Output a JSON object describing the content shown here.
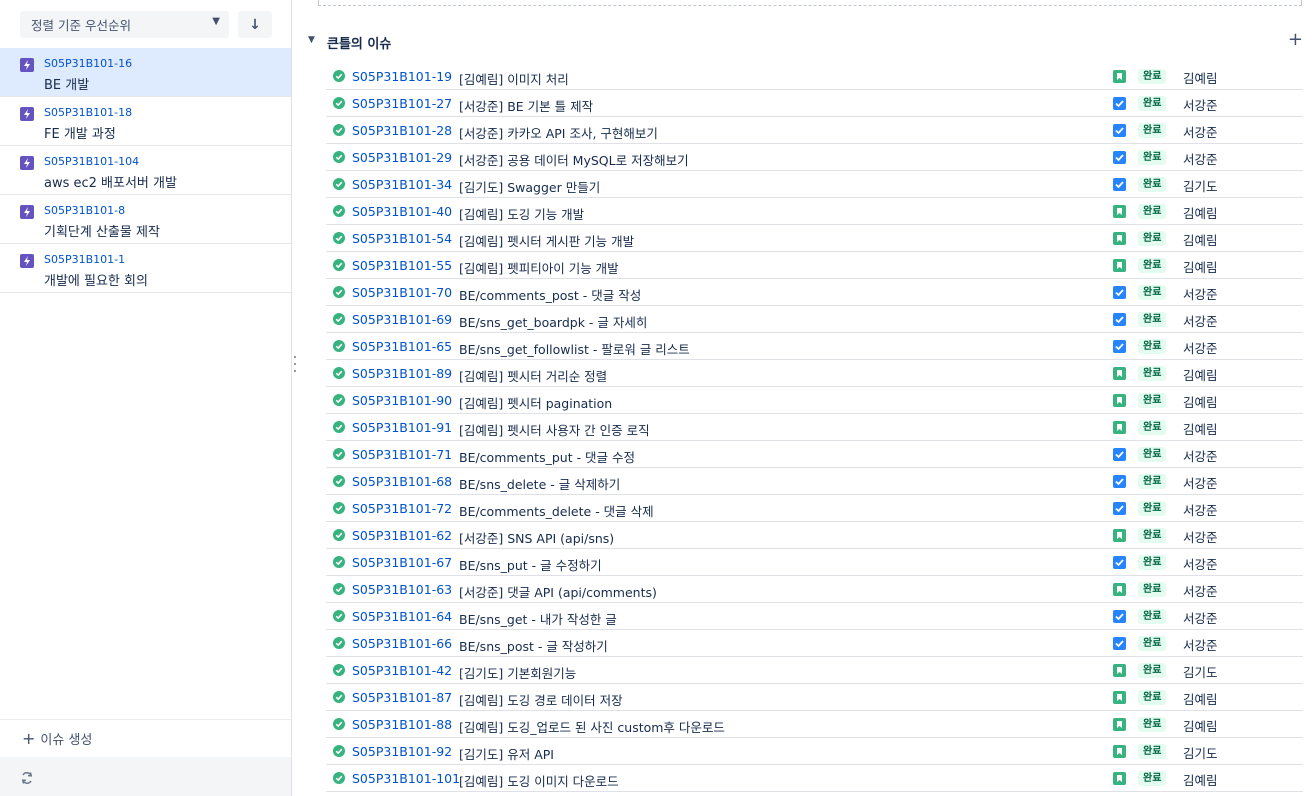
{
  "sidebar": {
    "sort_label": "정렬 기준 우선순위",
    "sort_direction_icon": "arrow-down-icon",
    "epics": [
      {
        "key": "S05P31B101-16",
        "title": "BE 개발"
      },
      {
        "key": "S05P31B101-18",
        "title": "FE 개발 과정"
      },
      {
        "key": "S05P31B101-104",
        "title": "aws ec2 배포서버 개발"
      },
      {
        "key": "S05P31B101-8",
        "title": "기획단계 산출물 제작"
      },
      {
        "key": "S05P31B101-1",
        "title": "개발에 필요한 회의"
      }
    ],
    "selected_epic_index": 0,
    "create_issue_label": "이슈 생성"
  },
  "section": {
    "title": "큰틀의 이슈"
  },
  "colors": {
    "epic": "#6554c0",
    "done_green": "#36b37e",
    "task_blue": "#2684ff",
    "link_blue": "#0052cc",
    "badge_bg": "#e3fcef",
    "badge_text": "#006644",
    "selected_bg": "#deebff"
  },
  "issues": [
    {
      "key": "S05P31B101-19",
      "summary": "[김예림] 이미지 처리",
      "type": "story",
      "status": "완료",
      "assignee": "김예림"
    },
    {
      "key": "S05P31B101-27",
      "summary": "[서강준] BE 기본 틀 제작",
      "type": "task",
      "status": "완료",
      "assignee": "서강준"
    },
    {
      "key": "S05P31B101-28",
      "summary": "[서강준] 카카오 API 조사, 구현해보기",
      "type": "task",
      "status": "완료",
      "assignee": "서강준"
    },
    {
      "key": "S05P31B101-29",
      "summary": "[서강준] 공용 데이터 MySQL로 저장해보기",
      "type": "task",
      "status": "완료",
      "assignee": "서강준"
    },
    {
      "key": "S05P31B101-34",
      "summary": "[김기도] Swagger 만들기",
      "type": "task",
      "status": "완료",
      "assignee": "김기도"
    },
    {
      "key": "S05P31B101-40",
      "summary": "[김예림] 도깅 기능 개발",
      "type": "story",
      "status": "완료",
      "assignee": "김예림"
    },
    {
      "key": "S05P31B101-54",
      "summary": "[김예림] 펫시터 게시판 기능 개발",
      "type": "story",
      "status": "완료",
      "assignee": "김예림"
    },
    {
      "key": "S05P31B101-55",
      "summary": "[김예림] 펫피티아이 기능 개발",
      "type": "story",
      "status": "완료",
      "assignee": "김예림"
    },
    {
      "key": "S05P31B101-70",
      "summary": "BE/comments_post - 댓글 작성",
      "type": "task",
      "status": "완료",
      "assignee": "서강준"
    },
    {
      "key": "S05P31B101-69",
      "summary": "BE/sns_get_boardpk - 글 자세히",
      "type": "task",
      "status": "완료",
      "assignee": "서강준"
    },
    {
      "key": "S05P31B101-65",
      "summary": "BE/sns_get_followlist - 팔로워 글 리스트",
      "type": "task",
      "status": "완료",
      "assignee": "서강준"
    },
    {
      "key": "S05P31B101-89",
      "summary": "[김예림] 펫시터 거리순 정렬",
      "type": "story",
      "status": "완료",
      "assignee": "김예림"
    },
    {
      "key": "S05P31B101-90",
      "summary": "[김예림] 펫시터 pagination",
      "type": "story",
      "status": "완료",
      "assignee": "김예림"
    },
    {
      "key": "S05P31B101-91",
      "summary": "[김예림] 펫시터 사용자 간 인증 로직",
      "type": "story",
      "status": "완료",
      "assignee": "김예림"
    },
    {
      "key": "S05P31B101-71",
      "summary": "BE/comments_put - 댓글 수정",
      "type": "task",
      "status": "완료",
      "assignee": "서강준"
    },
    {
      "key": "S05P31B101-68",
      "summary": "BE/sns_delete - 글 삭제하기",
      "type": "task",
      "status": "완료",
      "assignee": "서강준"
    },
    {
      "key": "S05P31B101-72",
      "summary": "BE/comments_delete - 댓글 삭제",
      "type": "task",
      "status": "완료",
      "assignee": "서강준"
    },
    {
      "key": "S05P31B101-62",
      "summary": "[서강준] SNS API (api/sns)",
      "type": "story",
      "status": "완료",
      "assignee": "서강준"
    },
    {
      "key": "S05P31B101-67",
      "summary": "BE/sns_put - 글 수정하기",
      "type": "task",
      "status": "완료",
      "assignee": "서강준"
    },
    {
      "key": "S05P31B101-63",
      "summary": "[서강준] 댓글 API (api/comments)",
      "type": "story",
      "status": "완료",
      "assignee": "서강준"
    },
    {
      "key": "S05P31B101-64",
      "summary": "BE/sns_get - 내가 작성한 글",
      "type": "task",
      "status": "완료",
      "assignee": "서강준"
    },
    {
      "key": "S05P31B101-66",
      "summary": "BE/sns_post - 글 작성하기",
      "type": "task",
      "status": "완료",
      "assignee": "서강준"
    },
    {
      "key": "S05P31B101-42",
      "summary": "[김기도] 기본회원기능",
      "type": "story",
      "status": "완료",
      "assignee": "김기도"
    },
    {
      "key": "S05P31B101-87",
      "summary": "[김예림] 도깅 경로 데이터 저장",
      "type": "story",
      "status": "완료",
      "assignee": "김예림"
    },
    {
      "key": "S05P31B101-88",
      "summary": "[김예림] 도깅_업로드 된 사진 custom후 다운로드",
      "type": "story",
      "status": "완료",
      "assignee": "김예림"
    },
    {
      "key": "S05P31B101-92",
      "summary": "[김기도] 유저 API",
      "type": "story",
      "status": "완료",
      "assignee": "김기도"
    },
    {
      "key": "S05P31B101-101",
      "summary": "[김예림] 도깅 이미지 다운로드",
      "type": "story",
      "status": "완료",
      "assignee": "김예림"
    }
  ]
}
